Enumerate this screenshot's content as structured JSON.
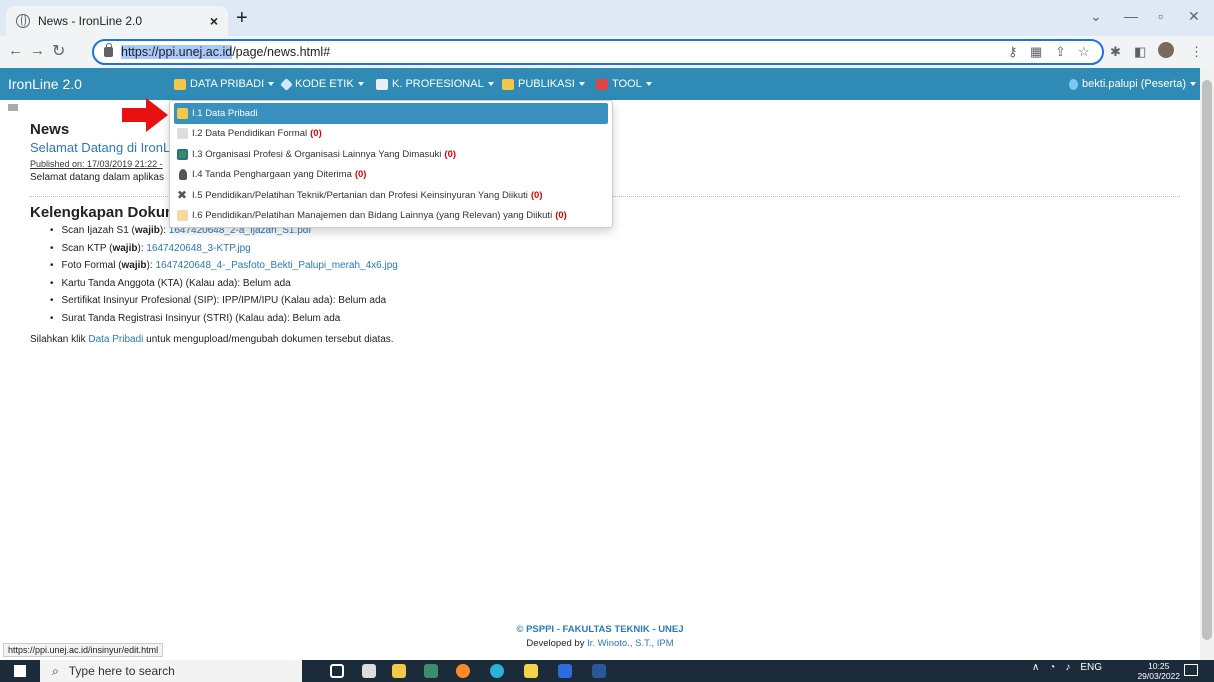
{
  "browser": {
    "tab_title": "News - IronLine 2.0",
    "url_host": "https://ppi.unej.ac.id",
    "url_path": "/page/news.html#"
  },
  "navbar": {
    "brand": "IronLine 2.0",
    "menus": [
      {
        "label": "DATA PRIBADI",
        "icon": "pencil-icon"
      },
      {
        "label": "KODE ETIK",
        "icon": "diamond-icon"
      },
      {
        "label": "K. PROFESIONAL",
        "icon": "list-icon"
      },
      {
        "label": "PUBLIKASI",
        "icon": "book-icon"
      },
      {
        "label": "TOOL",
        "icon": "floppy-icon"
      }
    ],
    "user": "bekti.palupi (Peserta)"
  },
  "dropdown": {
    "items": [
      {
        "label": "I.1 Data Pribadi",
        "count": ""
      },
      {
        "label": "I.2 Data Pendidikan Formal",
        "count": "(0)"
      },
      {
        "label": "I.3 Organisasi Profesi & Organisasi Lainnya Yang Dimasuki",
        "count": "(0)"
      },
      {
        "label": "I.4 Tanda Penghargaan yang Diterima",
        "count": "(0)"
      },
      {
        "label": "I.5 Pendidikan/Pelatihan Teknik/Pertanian dan Profesi Keinsinyuran Yang Diikuti",
        "count": "(0)"
      },
      {
        "label": "I.6 Pendidikan/Pelatihan Manajemen dan Bidang Lainnya (yang Relevan) yang Diikuti",
        "count": "(0)"
      }
    ]
  },
  "news": {
    "heading": "News",
    "link": "Selamat Datang di IronLi",
    "published": "Published on: 17/03/2019 21:22  -",
    "welcome": "Selamat datang dalam aplikas"
  },
  "documents": {
    "heading": "Kelengkapan Dokum",
    "items": [
      {
        "prefix": "Scan Ijazah S1 (",
        "bold": "wajib",
        "suffix": "): ",
        "link": "1647420648_2-a_Ijazah_S1.pdf",
        "plain": ""
      },
      {
        "prefix": "Scan KTP (",
        "bold": "wajib",
        "suffix": "): ",
        "link": "1647420648_3-KTP.jpg",
        "plain": ""
      },
      {
        "prefix": "Foto Formal (",
        "bold": "wajib",
        "suffix": "): ",
        "link": "1647420648_4-_Pasfoto_Bekti_Palupi_merah_4x6.jpg",
        "plain": ""
      },
      {
        "prefix": "Kartu Tanda Anggota (KTA) (Kalau ada): ",
        "bold": "",
        "suffix": "",
        "link": "",
        "plain": "Belum ada"
      },
      {
        "prefix": "Sertifikat Insinyur Profesional (SIP): IPP/IPM/IPU (Kalau ada): ",
        "bold": "",
        "suffix": "",
        "link": "",
        "plain": "Belum ada"
      },
      {
        "prefix": "Surat Tanda Registrasi Insinyur (STRI) (Kalau ada): ",
        "bold": "",
        "suffix": "",
        "link": "",
        "plain": "Belum ada"
      }
    ],
    "note_pre": "Silahkan klik ",
    "note_link": "Data Pribadi",
    "note_post": " untuk mengupload/mengubah dokumen tersebut diatas."
  },
  "footer": {
    "line1": "© PSPPI - FAKULTAS TEKNIK - UNEJ",
    "line2_pre": "Developed by ",
    "line2_link": "Ir. Winoto., S.T., IPM"
  },
  "status_url": "https://ppi.unej.ac.id/insinyur/edit.html",
  "taskbar": {
    "search_placeholder": "Type here to search",
    "lang": "ENG",
    "time": "10:25",
    "date": "29/03/2022"
  },
  "colors": {
    "navbar": "#2f8bb6",
    "accent": "#1a73e8",
    "count": "#dd0000",
    "arrow": "#e81010"
  }
}
